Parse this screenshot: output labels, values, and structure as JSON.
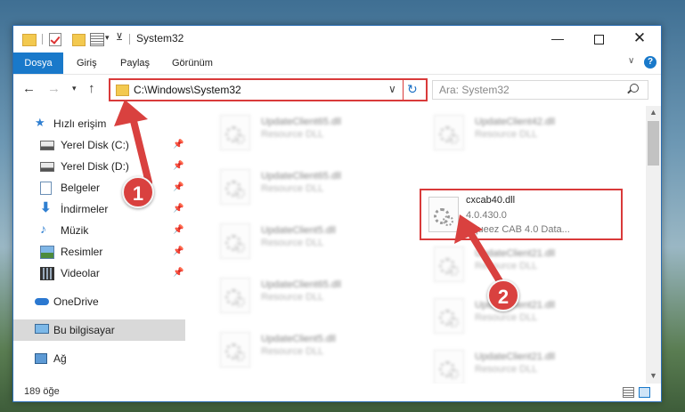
{
  "window": {
    "title": "System32",
    "controls": {
      "minimize": "—",
      "close": "✕"
    }
  },
  "ribbon": {
    "tabs": [
      "Dosya",
      "Giriş",
      "Paylaş",
      "Görünüm"
    ]
  },
  "navigation": {
    "address": "C:\\Windows\\System32",
    "search_placeholder": "Ara: System32"
  },
  "sidebar": {
    "quick_access": "Hızlı erişim",
    "items": [
      "Yerel Disk (C:)",
      "Yerel Disk (D:)",
      "Belgeler",
      "İndirmeler",
      "Müzik",
      "Resimler",
      "Videolar"
    ],
    "onedrive": "OneDrive",
    "this_pc": "Bu bilgisayar",
    "network": "Ağ"
  },
  "files": {
    "left_column": [
      {
        "name": "UpdateClient65.dll",
        "desc": "Resource DLL"
      },
      {
        "name": "UpdateClient65.dll",
        "desc": "Resource DLL"
      },
      {
        "name": "UpdateClient5.dll",
        "desc": "Resource DLL"
      },
      {
        "name": "UpdateClient65.dll",
        "desc": "Resource DLL"
      },
      {
        "name": "UpdateClient5.dll",
        "desc": "Resource DLL"
      }
    ],
    "right_column": [
      {
        "name": "UpdateClient42.dll",
        "desc": "Resource DLL"
      },
      {
        "name": "UpdateClient21.dll",
        "desc": "Resource DLL"
      },
      {
        "name": "UpdateClient21.dll",
        "desc": "Resource DLL"
      },
      {
        "name": "UpdateClient21.dll",
        "desc": "Resource DLL"
      }
    ],
    "highlighted": {
      "name": "cxcab40.dll",
      "version": "4.0.430.0",
      "desc": "Squeez CAB 4.0 Data..."
    }
  },
  "status": {
    "item_count": "189 öğe"
  },
  "annotations": {
    "step1": "1",
    "step2": "2",
    "color": "#d9413f"
  }
}
